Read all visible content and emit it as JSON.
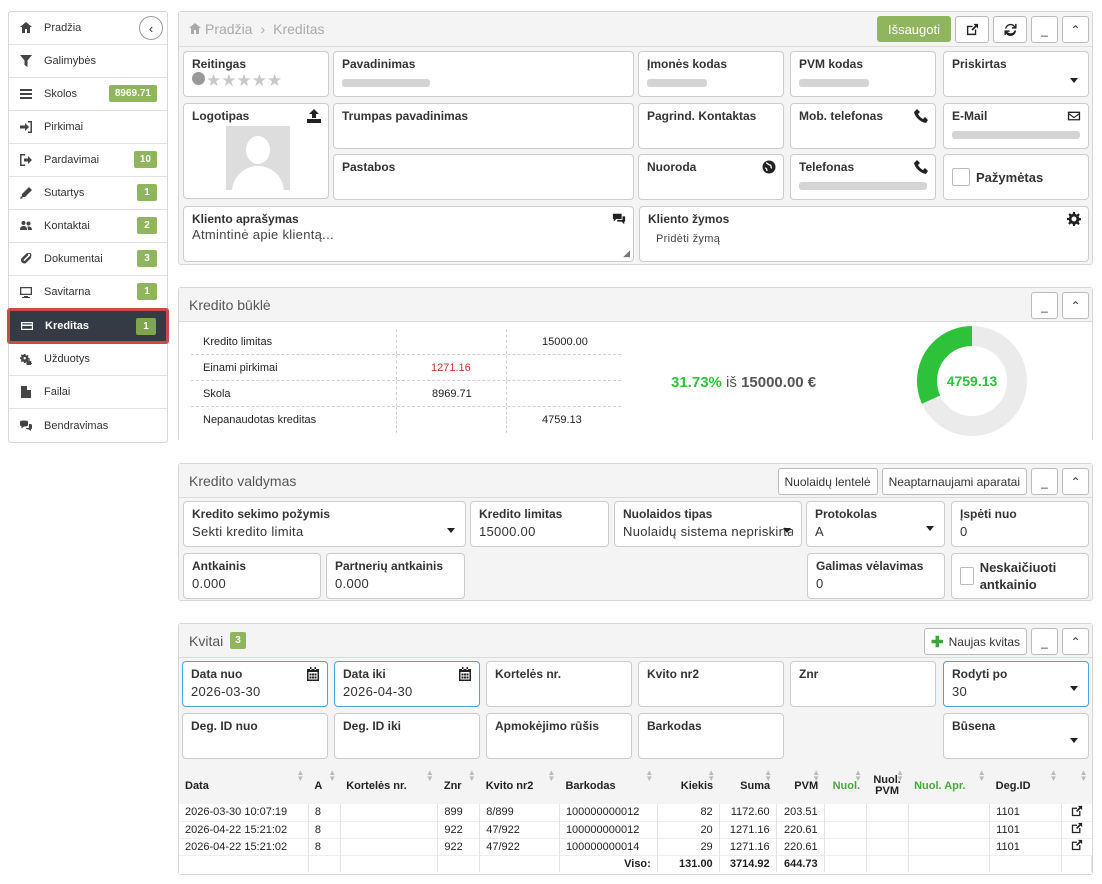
{
  "sidebar": {
    "items": [
      {
        "label": "Pradžia",
        "icon": "home-icon"
      },
      {
        "label": "Galimybės",
        "icon": "filter-icon"
      },
      {
        "label": "Skolos",
        "icon": "list-icon",
        "badge": "8969.71"
      },
      {
        "label": "Pirkimai",
        "icon": "sign-in-icon"
      },
      {
        "label": "Pardavimai",
        "icon": "sign-out-icon",
        "badge": "10"
      },
      {
        "label": "Sutartys",
        "icon": "pencil-icon",
        "badge": "1"
      },
      {
        "label": "Kontaktai",
        "icon": "users-icon",
        "badge": "2"
      },
      {
        "label": "Dokumentai",
        "icon": "paperclip-icon",
        "badge": "3"
      },
      {
        "label": "Savitarna",
        "icon": "monitor-icon",
        "badge": "1"
      },
      {
        "label": "Kreditas",
        "icon": "credit-card-icon",
        "badge": "1",
        "active": true
      },
      {
        "label": "Užduotys",
        "icon": "cogs-icon"
      },
      {
        "label": "Failai",
        "icon": "file-icon"
      },
      {
        "label": "Bendravimas",
        "icon": "comments-icon"
      }
    ]
  },
  "header": {
    "breadcrumb_home": "Pradžia",
    "breadcrumb_sep": "›",
    "breadcrumb_current": "Kreditas",
    "save": "Išsaugoti"
  },
  "client": {
    "reitingas": "Reitingas",
    "pavadinimas": "Pavadinimas",
    "imones_kodas": "Įmonės kodas",
    "pvm_kodas": "PVM kodas",
    "priskirtas": "Priskirtas",
    "logotipas": "Logotipas",
    "trumpas": "Trumpas pavadinimas",
    "pagrind": "Pagrind. Kontaktas",
    "mob": "Mob. telefonas",
    "email": "E-Mail",
    "pastabos": "Pastabos",
    "nuoroda": "Nuoroda",
    "telefonas": "Telefonas",
    "pazymetas": "Pažymėtas",
    "aprasymas": "Kliento aprašymas",
    "aprasymas_ph": "Atmintinė apie klientą...",
    "zymos": "Kliento žymos",
    "prideti": "Pridėti žymą"
  },
  "credit_state": {
    "title": "Kredito būklė",
    "rows": [
      {
        "label": "Kredito limitas",
        "a": "",
        "b": "",
        "c": "15000.00"
      },
      {
        "label": "Einami pirkimai",
        "a": "1271.16",
        "b": "",
        "c": ""
      },
      {
        "label": "Skola",
        "a": "",
        "b": "8969.71",
        "c": ""
      },
      {
        "label": "Nepanaudotas kreditas",
        "a": "",
        "b": "",
        "c": "4759.13"
      }
    ],
    "percent": "31.73%",
    "of_text": "iš",
    "total": "15000.00 €",
    "donut_value": "4759.13",
    "fraction": 0.3173,
    "color_used": "#2ec23a",
    "color_rest": "#ebebeb"
  },
  "credit_mgmt": {
    "title": "Kredito valdymas",
    "btn1": "Nuolaidų lentelė",
    "btn2": "Neaptarnaujami aparatai",
    "f1_label": "Kredito sekimo požymis",
    "f1_value": "Sekti kredito limita",
    "f2_label": "Kredito limitas",
    "f2_value": "15000.00",
    "f3_label": "Nuolaidos tipas",
    "f3_value": "Nuolaidų sistema nepriskirta",
    "f4_label": "Protokolas",
    "f4_value": "A",
    "f5_label": "Įspėti nuo",
    "f5_value": "0",
    "f6_label": "Antkainis",
    "f6_value": "0.000",
    "f7_label": "Partnerių antkainis",
    "f7_value": "0.000",
    "f8_label": "Galimas vėlavimas",
    "f8_value": "0",
    "f9_label": "Neskaičiuoti antkainio"
  },
  "kvitai": {
    "title": "Kvitai",
    "count": "3",
    "new_btn": "Naujas kvitas",
    "data_nuo_label": "Data nuo",
    "data_nuo": "2026-03-30",
    "data_iki_label": "Data iki",
    "data_iki": "2026-04-30",
    "korteles": "Kortelės nr.",
    "kvito_nr2": "Kvito nr2",
    "znr": "Znr",
    "rodyti_po": "Rodyti po",
    "rodyti_po_val": "30",
    "deg_nuo": "Deg. ID nuo",
    "deg_iki": "Deg. ID iki",
    "apmokejimo": "Apmokėjimo rūšis",
    "barkodas": "Barkodas",
    "busena": "Būsena",
    "columns": [
      "Data",
      "A",
      "Kortelės nr.",
      "Znr",
      "Kvito nr2",
      "Barkodas",
      "Kiekis",
      "Suma",
      "PVM",
      "Nuol.",
      "Nuol. PVM",
      "Nuol. Apr.",
      "Deg.ID",
      ""
    ],
    "rows": [
      [
        "2026-03-30 10:07:19",
        "8",
        "",
        "899",
        "8/899",
        "100000000012",
        "82",
        "1172.60",
        "203.51",
        "",
        "",
        "",
        "1101"
      ],
      [
        "2026-04-22 15:21:02",
        "8",
        "",
        "922",
        "47/922",
        "100000000012",
        "20",
        "1271.16",
        "220.61",
        "",
        "",
        "",
        "1101"
      ],
      [
        "2026-04-22 15:21:02",
        "8",
        "",
        "922",
        "47/922",
        "100000000014",
        "29",
        "1271.16",
        "220.61",
        "",
        "",
        "",
        "1101"
      ]
    ],
    "total_label": "Viso:",
    "total_kiekis": "131.00",
    "total_suma": "3714.92",
    "total_pvm": "644.73"
  }
}
